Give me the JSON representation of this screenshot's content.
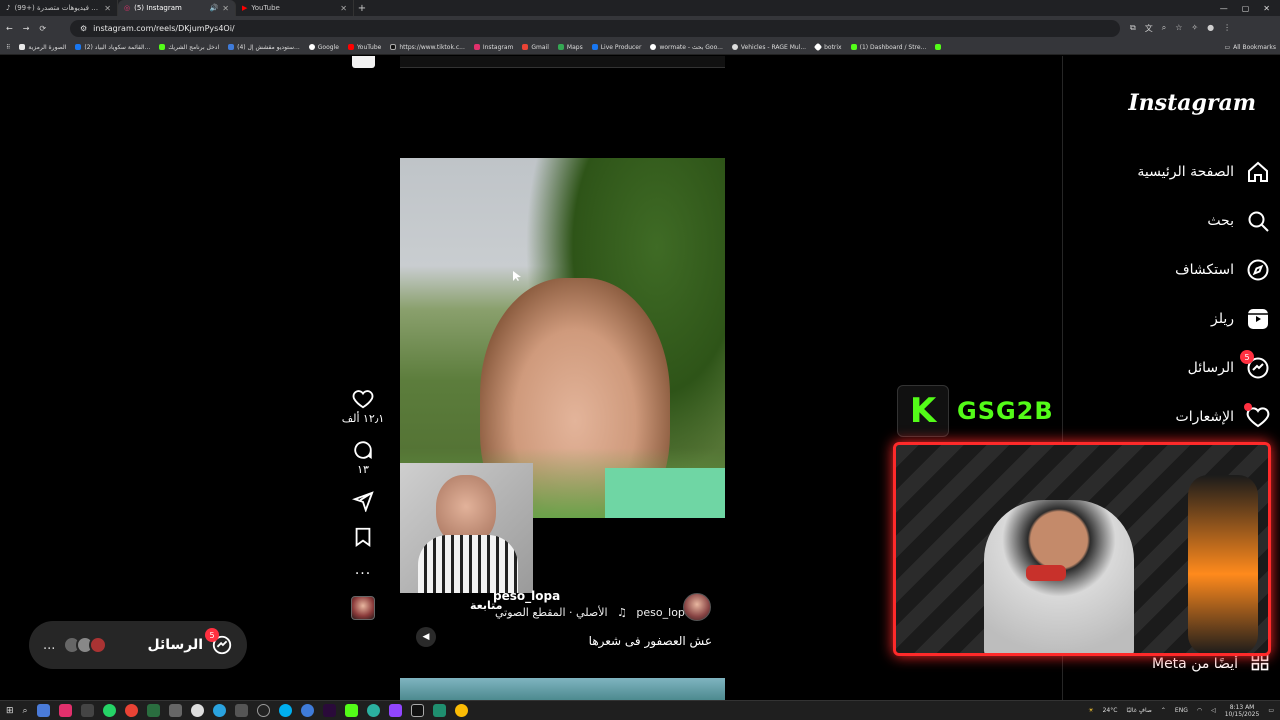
{
  "browser": {
    "tabs": [
      {
        "label": "(99+) شاهد فيديوهات متصدرة",
        "active": false
      },
      {
        "label": "(5) Instagram",
        "active": true
      },
      {
        "label": "YouTube",
        "active": false
      }
    ],
    "new_tab": "+",
    "url": "instagram.com/reels/DKjumPys4Oi/",
    "bookmarks": [
      {
        "label": "الصورة الرمزية",
        "color": "#e8e8e8"
      },
      {
        "label": "(2) القائمة سكوياد البياد...",
        "color": "#1877f2"
      },
      {
        "label": "ادخل برنامج الشريك",
        "color": "#53fc18"
      },
      {
        "label": "(4) ستوديو مقشش إل...",
        "color": "#3f7bd9"
      },
      {
        "label": "Google",
        "color": "#ffffff"
      },
      {
        "label": "YouTube",
        "color": "#ff0000"
      },
      {
        "label": "https://www.tiktok.c...",
        "color": "#111111"
      },
      {
        "label": "Instagram",
        "color": "#e1306c"
      },
      {
        "label": "Gmail",
        "color": "#ea4335"
      },
      {
        "label": "Maps",
        "color": "#34a853"
      },
      {
        "label": "Live Producer",
        "color": "#1877f2"
      },
      {
        "label": "wormate - بحث Goo...",
        "color": "#ffffff"
      },
      {
        "label": "Vehicles - RAGE Mul...",
        "color": "#dddddd"
      },
      {
        "label": "botrix",
        "color": "#ffffff"
      },
      {
        "label": "(1) Dashboard / Stre...",
        "color": "#53fc18"
      }
    ],
    "all_bookmarks": "All Bookmarks"
  },
  "reel": {
    "username": "peso_lopa",
    "follow_label": "متابعة",
    "audio_user": "peso_lopa",
    "audio_label": "الأصلي · المقطع الصوتي",
    "caption": "عش العصفور فى شعرها",
    "likes": "١٢٫١ ألف",
    "comments": "١٣",
    "more": "..."
  },
  "messages_pill": {
    "label": "الرسائل",
    "badge": "5",
    "more": "..."
  },
  "sidebar": {
    "logo": "Instagram",
    "items": [
      {
        "label": "الصفحة الرئيسية",
        "icon": "home-icon"
      },
      {
        "label": "بحث",
        "icon": "search-icon"
      },
      {
        "label": "استكشاف",
        "icon": "compass-icon"
      },
      {
        "label": "ريلز",
        "icon": "reels-icon"
      },
      {
        "label": "الرسائل",
        "icon": "messenger-icon",
        "badge": "5"
      },
      {
        "label": "الإشعارات",
        "icon": "heart-icon"
      }
    ],
    "meta_more": "أيضًا من Meta"
  },
  "overlay": {
    "kick_letter": "K",
    "channel_name": "GSG2B",
    "accent": "#53fc18",
    "frame_color": "#ff2a2a"
  },
  "taskbar": {
    "weather": "24°C",
    "weather_desc": "صافٍ غالبًا",
    "lang": "ENG",
    "time": "8:13 AM",
    "date": "10/15/2025"
  }
}
